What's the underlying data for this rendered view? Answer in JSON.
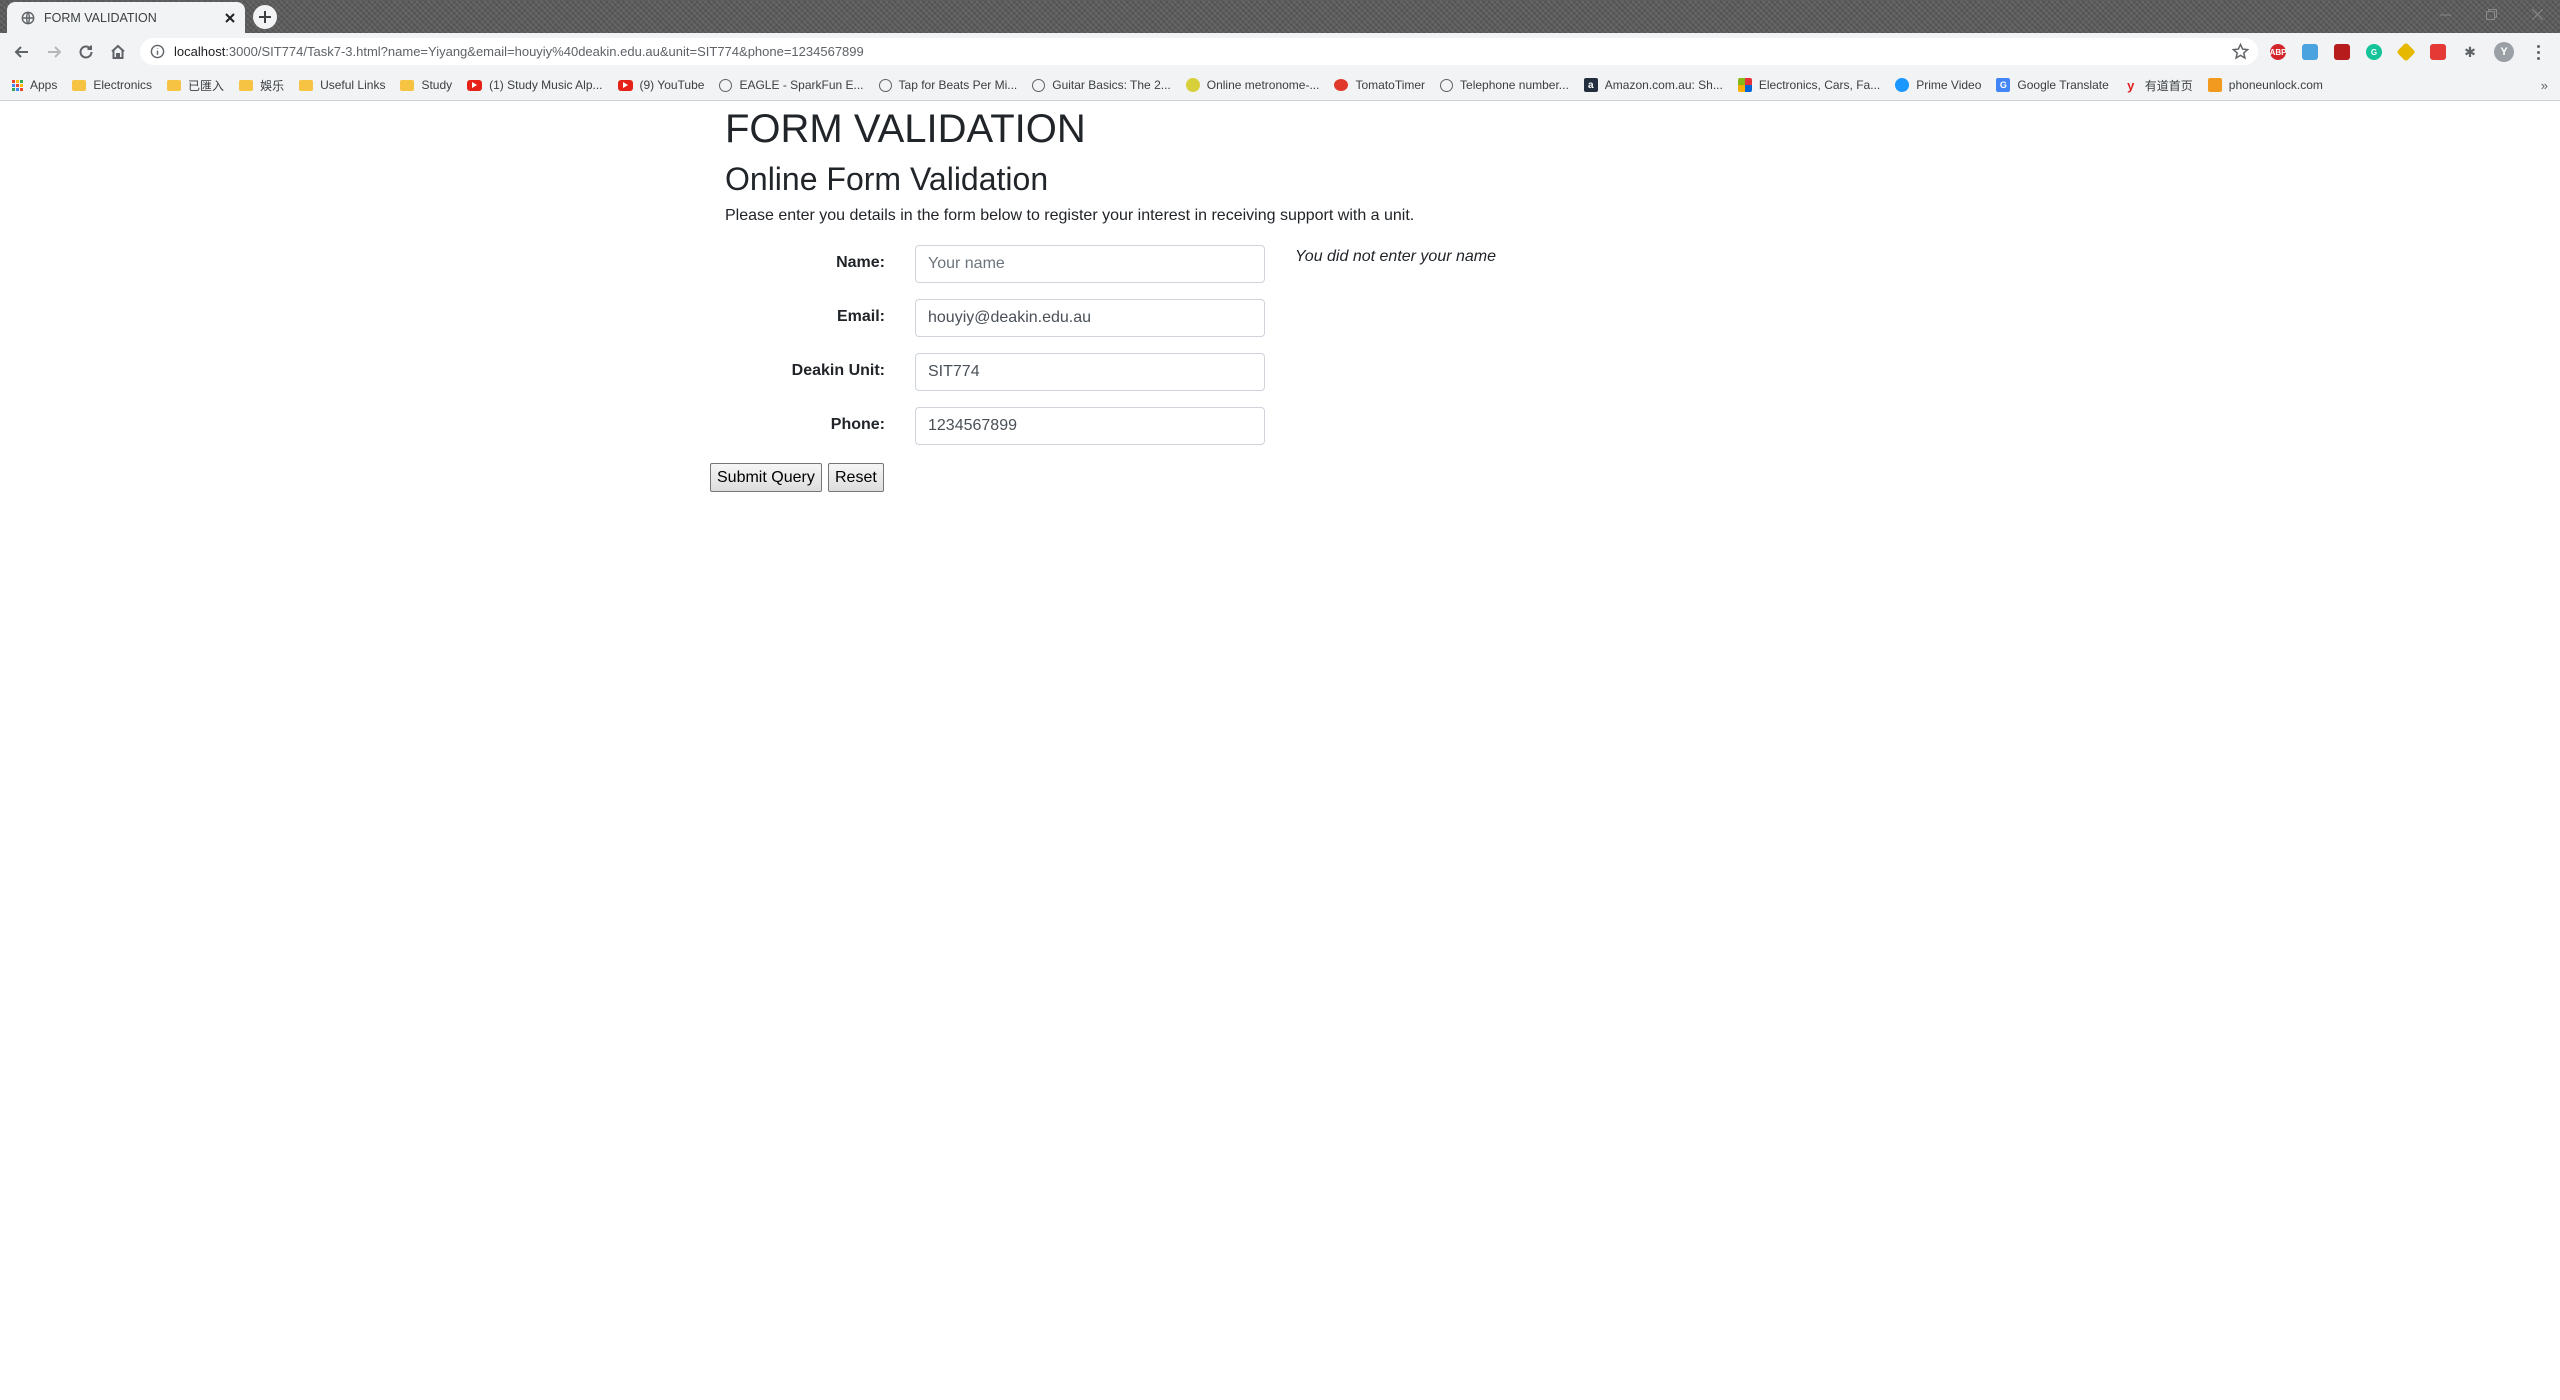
{
  "browser": {
    "tab_title": "FORM VALIDATION",
    "url_host": "localhost",
    "url_rest": ":3000/SIT774/Task7-3.html?name=Yiyang&email=houyiy%40deakin.edu.au&unit=SIT774&phone=1234567899"
  },
  "bookmarks": [
    {
      "label": "Apps",
      "icon": "apps-icon"
    },
    {
      "label": "Electronics",
      "icon": "folder-icon"
    },
    {
      "label": "已匯入",
      "icon": "folder-icon"
    },
    {
      "label": "娛乐",
      "icon": "folder-icon"
    },
    {
      "label": "Useful Links",
      "icon": "folder-icon"
    },
    {
      "label": "Study",
      "icon": "folder-icon"
    },
    {
      "label": "(1) Study Music Alp...",
      "icon": "youtube-icon"
    },
    {
      "label": "(9) YouTube",
      "icon": "youtube-icon"
    },
    {
      "label": "EAGLE - SparkFun E...",
      "icon": "globe-icon"
    },
    {
      "label": "Tap for Beats Per Mi...",
      "icon": "globe-icon"
    },
    {
      "label": "Guitar Basics: The 2...",
      "icon": "globe-icon"
    },
    {
      "label": "Online metronome-...",
      "icon": "metronome-icon"
    },
    {
      "label": "TomatoTimer",
      "icon": "tomato-icon"
    },
    {
      "label": "Telephone number...",
      "icon": "globe-icon"
    },
    {
      "label": "Amazon.com.au: Sh...",
      "icon": "amazon-icon"
    },
    {
      "label": "Electronics, Cars, Fa...",
      "icon": "ebay-icon"
    },
    {
      "label": "Prime Video",
      "icon": "prime-video-icon"
    },
    {
      "label": "Google Translate",
      "icon": "google-translate-icon"
    },
    {
      "label": "有道首页",
      "icon": "youdao-icon"
    },
    {
      "label": "phoneunlock.com",
      "icon": "phoneunlock-icon"
    }
  ],
  "page": {
    "title": "FORM VALIDATION",
    "subtitle": "Online Form Validation",
    "intro": "Please enter you details in the form below to register your interest in receiving support with a unit."
  },
  "form": {
    "name": {
      "label": "Name:",
      "value": "",
      "placeholder": "Your name",
      "error": "You did not enter your name"
    },
    "email": {
      "label": "Email:",
      "value": "houyiy@deakin.edu.au",
      "placeholder": ""
    },
    "unit": {
      "label": "Deakin Unit:",
      "value": "SIT774",
      "placeholder": ""
    },
    "phone": {
      "label": "Phone:",
      "value": "1234567899",
      "placeholder": ""
    },
    "submit_label": "Submit Query",
    "reset_label": "Reset"
  }
}
